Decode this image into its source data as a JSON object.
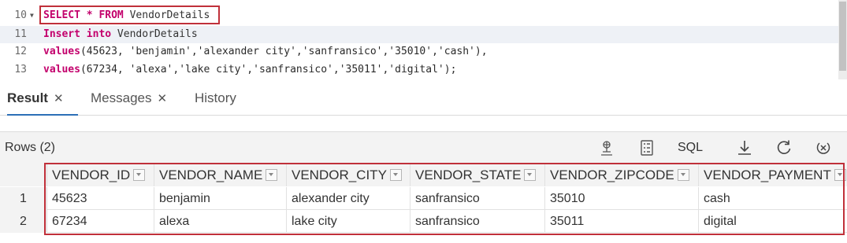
{
  "editor": {
    "lines": [
      {
        "num": "10",
        "tokens": [
          {
            "t": "SELECT",
            "k": "kw"
          },
          {
            "t": " ",
            "k": ""
          },
          {
            "t": "*",
            "k": "kw"
          },
          {
            "t": " ",
            "k": ""
          },
          {
            "t": "FROM",
            "k": "kw"
          },
          {
            "t": " VendorDetails",
            "k": ""
          }
        ]
      },
      {
        "num": "11",
        "tokens": [
          {
            "t": "Insert",
            "k": "kw"
          },
          {
            "t": " ",
            "k": ""
          },
          {
            "t": "into",
            "k": "kw"
          },
          {
            "t": " VendorDetails",
            "k": ""
          }
        ]
      },
      {
        "num": "12",
        "tokens": [
          {
            "t": "values",
            "k": "kw"
          },
          {
            "t": "(45623, 'benjamin','alexander city','sanfransico','35010','cash'),",
            "k": "str"
          }
        ]
      },
      {
        "num": "13",
        "tokens": [
          {
            "t": "values",
            "k": "kw"
          },
          {
            "t": "(67234, 'alexa','lake city','sanfransico','35011','digital');",
            "k": "str"
          }
        ]
      }
    ]
  },
  "tabs": [
    {
      "label": "Result",
      "closable": true,
      "active": true
    },
    {
      "label": "Messages",
      "closable": true,
      "active": false
    },
    {
      "label": "History",
      "closable": false,
      "active": false
    }
  ],
  "toolbar": {
    "rows_label": "Rows (2)",
    "sql_label": "SQL",
    "icons": [
      "chart-icon",
      "details-icon",
      "download-icon",
      "refresh-icon",
      "clear-icon"
    ]
  },
  "grid": {
    "columns": [
      "VENDOR_ID",
      "VENDOR_NAME",
      "VENDOR_CITY",
      "VENDOR_STATE",
      "VENDOR_ZIPCODE",
      "VENDOR_PAYMENT"
    ],
    "rows": [
      {
        "num": "1",
        "cells": [
          "45623",
          "benjamin",
          "alexander city",
          "sanfransico",
          "35010",
          "cash"
        ]
      },
      {
        "num": "2",
        "cells": [
          "67234",
          "alexa",
          "lake city",
          "sanfransico",
          "35011",
          "digital"
        ]
      }
    ]
  }
}
